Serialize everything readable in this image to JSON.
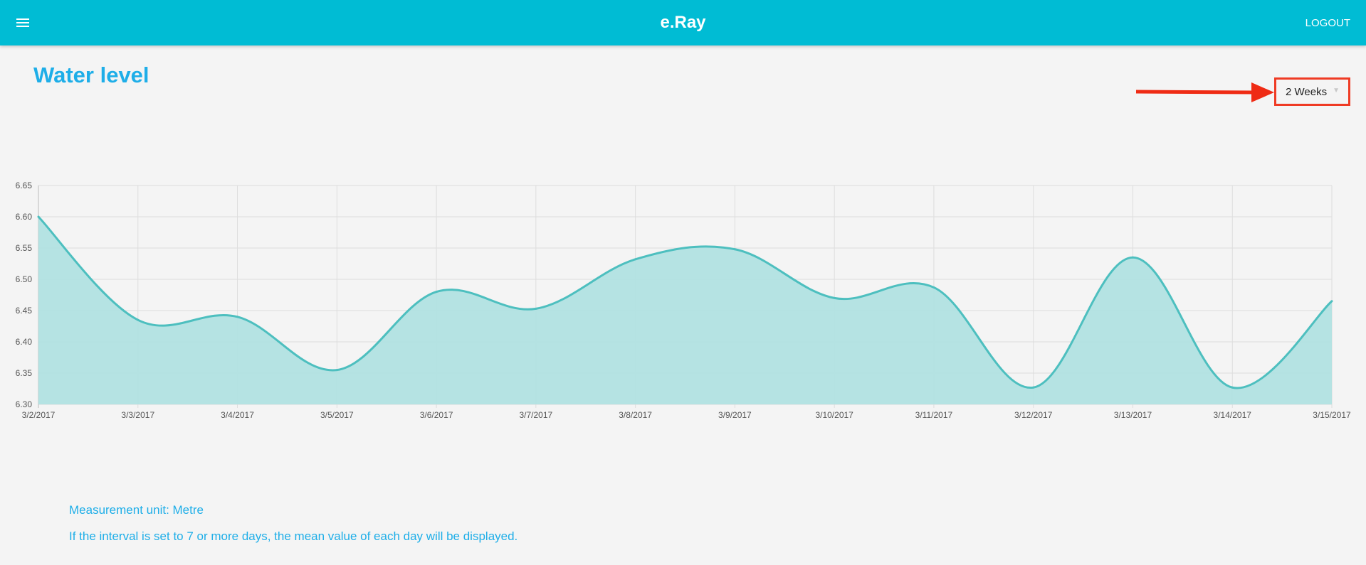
{
  "header": {
    "app_title": "e.Ray",
    "logout_label": "LOGOUT",
    "menu_icon": "hamburger-menu-icon",
    "background_color": "#00bcd4"
  },
  "page": {
    "title": "Water level"
  },
  "interval_select": {
    "value": "2 Weeks",
    "caret_icon": "caret-down-icon",
    "highlight_color": "#ef3b24"
  },
  "chart_data": {
    "type": "area",
    "categories": [
      "3/2/2017",
      "3/3/2017",
      "3/4/2017",
      "3/5/2017",
      "3/6/2017",
      "3/7/2017",
      "3/8/2017",
      "3/9/2017",
      "3/10/2017",
      "3/11/2017",
      "3/12/2017",
      "3/13/2017",
      "3/14/2017",
      "3/15/2017"
    ],
    "values": [
      6.6,
      6.435,
      6.44,
      6.355,
      6.48,
      6.453,
      6.532,
      6.548,
      6.47,
      6.487,
      6.327,
      6.535,
      6.327,
      6.465
    ],
    "ylim": [
      6.3,
      6.65
    ],
    "yticks": [
      "6.30",
      "6.35",
      "6.40",
      "6.45",
      "6.50",
      "6.55",
      "6.60",
      "6.65"
    ],
    "grid": true,
    "line_color": "#4dbfbf",
    "fill_color": "#b1e1e1"
  },
  "notes": {
    "unit": "Measurement unit: Metre",
    "interval_info": "If the interval is set to 7 or more days, the mean value of each day will be displayed."
  }
}
